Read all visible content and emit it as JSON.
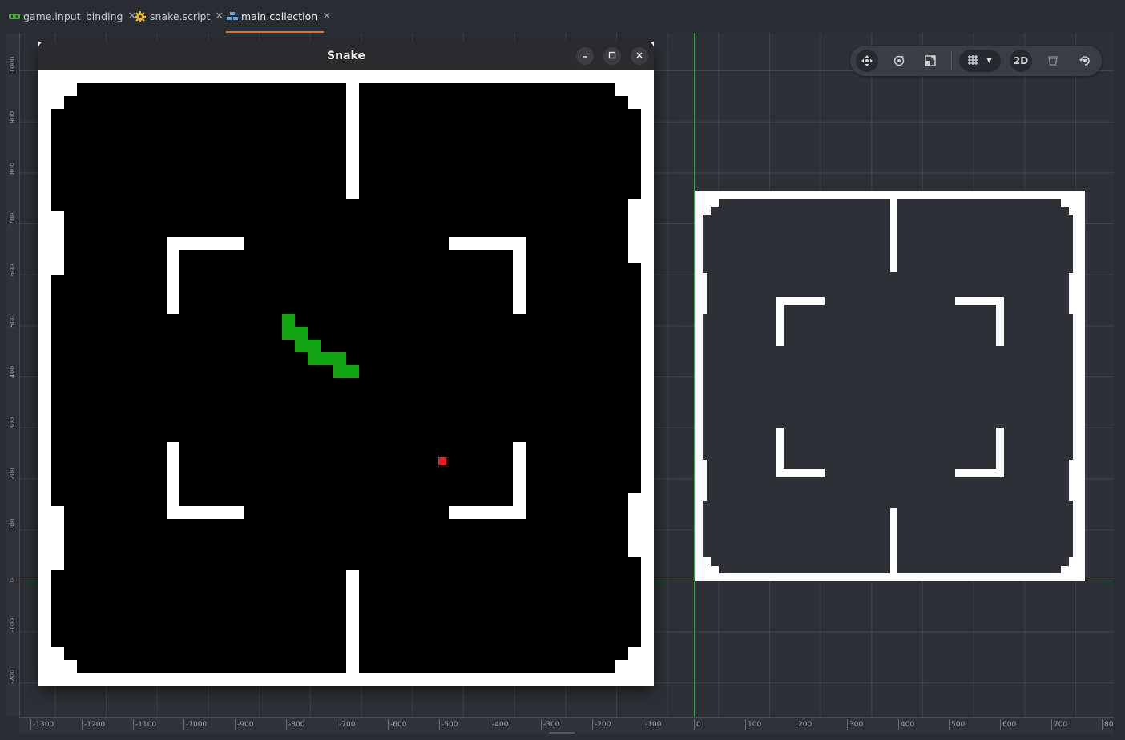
{
  "tabs": [
    {
      "label": "game.input_binding",
      "icon": "input-binding-icon",
      "active": false
    },
    {
      "label": "snake.script",
      "icon": "script-gear-icon",
      "active": false
    },
    {
      "label": "main.collection",
      "icon": "collection-icon",
      "active": true
    }
  ],
  "snake_window": {
    "title": "Snake",
    "controls": [
      "minimize",
      "maximize",
      "close"
    ]
  },
  "ruler_left": {
    "labels": [
      "1000",
      "900",
      "800",
      "700",
      "600",
      "500",
      "400",
      "300",
      "200",
      "100",
      "0",
      "-100",
      "-200"
    ]
  },
  "ruler_bottom": {
    "labels": [
      "-1300",
      "-1200",
      "-1100",
      "-1000",
      "-900",
      "-800",
      "-700",
      "-600",
      "-500",
      "-400",
      "-300",
      "-200",
      "-100",
      "0",
      "100",
      "200",
      "300",
      "400",
      "500",
      "600",
      "700",
      "80"
    ]
  },
  "toolbar": {
    "items": [
      {
        "name": "move-tool-icon"
      },
      {
        "name": "rotate-tool-icon"
      },
      {
        "name": "scale-tool-icon"
      },
      {
        "name": "grid-icon"
      },
      {
        "name": "chevron-down-icon"
      },
      {
        "name": "2d-toggle",
        "label": "2D"
      },
      {
        "name": "visibility-filter-icon"
      },
      {
        "name": "camera-reset-icon"
      }
    ]
  },
  "colors": {
    "snake": "#12a612",
    "food": "#e0201e",
    "wall": "#ffffff",
    "game_background": "#000000",
    "active_tab_underline": "#e0763f",
    "y_axis": "#3c9e44",
    "x_axis": "#8a3030"
  }
}
